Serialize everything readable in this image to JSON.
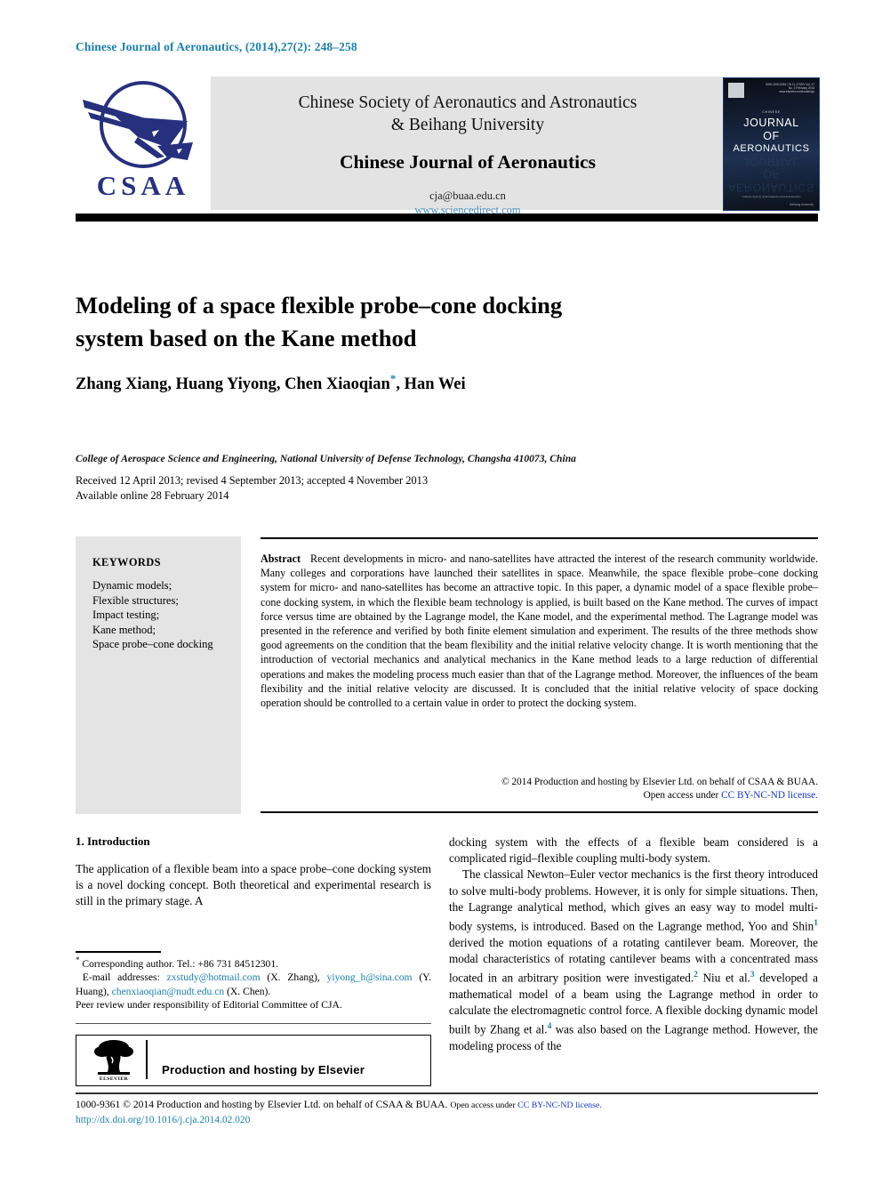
{
  "running_head": "Chinese Journal of Aeronautics, (2014),27(2): 248–258",
  "masthead": {
    "logo_text": "CSAA",
    "society_line1": "Chinese Society of Aeronautics and Astronautics",
    "society_line2": "& Beihang University",
    "journal_name": "Chinese Journal of Aeronautics",
    "email": "cja@buaa.edu.cn",
    "website": "www.sciencedirect.com",
    "cover": {
      "kicker": "CHINESE",
      "line1": "JOURNAL",
      "line2": "OF",
      "line3": "AERONAUTICS",
      "meta": "ISSN 1000-9361\nCN 11-1732/V\nVol. 27 No. 2 February 2014\nwww.elsevier.com/locate/cja",
      "footline": "Chinese Society of Aeronautics and Astronautics",
      "publisher": "Beihang University"
    }
  },
  "article": {
    "title_line1": "Modeling of a space flexible probe–cone docking",
    "title_line2": "system based on the Kane method",
    "authors": "Zhang Xiang, Huang Yiyong, Chen Xiaoqian",
    "authors_tail": ", Han Wei",
    "corresponding_marker": "*",
    "affiliation": "College of Aerospace Science and Engineering, National University of Defense Technology, Changsha 410073, China",
    "received": "Received 12 April 2013; revised 4 September 2013; accepted 4 November 2013",
    "available": "Available online 28 February 2014"
  },
  "keywords": {
    "heading": "KEYWORDS",
    "items": [
      "Dynamic models;",
      "Flexible structures;",
      "Impact testing;",
      "Kane method;",
      "Space probe–cone docking"
    ]
  },
  "abstract": {
    "label": "Abstract",
    "text": "Recent developments in micro- and nano-satellites have attracted the interest of the research community worldwide. Many colleges and corporations have launched their satellites in space. Meanwhile, the space flexible probe–cone docking system for micro- and nano-satellites has become an attractive topic. In this paper, a dynamic model of a space flexible probe–cone docking system, in which the flexible beam technology is applied, is built based on the Kane method. The curves of impact force versus time are obtained by the Lagrange model, the Kane model, and the experimental method. The Lagrange model was presented in the reference and verified by both finite element simulation and experiment. The results of the three methods show good agreements on the condition that the beam flexibility and the initial relative velocity change. It is worth mentioning that the introduction of vectorial mechanics and analytical mechanics in the Kane method leads to a large reduction of differential operations and makes the modeling process much easier than that of the Lagrange method. Moreover, the influences of the beam flexibility and the initial relative velocity are discussed. It is concluded that the initial relative velocity of space docking operation should be controlled to a certain value in order to protect the docking system.",
    "copyright": "© 2014 Production and hosting by Elsevier Ltd. on behalf of CSAA & BUAA.",
    "openaccess_prefix": "Open access under ",
    "license": "CC BY-NC-ND license."
  },
  "body": {
    "section_heading": "1. Introduction",
    "left_paragraph": "The application of a flexible beam into a space probe–cone docking system is a novel docking concept. Both theoretical and experimental research is still in the primary stage. A",
    "right_paragraph_1": "docking system with the effects of a flexible beam considered is a complicated rigid–flexible coupling multi-body system.",
    "right_paragraph_2_a": "The classical Newton–Euler vector mechanics is the first theory introduced to solve multi-body problems. However, it is only for simple situations. Then, the Lagrange analytical method, which gives an easy way to model multi-body systems, is introduced. Based on the Lagrange method, Yoo and Shin",
    "ref1": "1",
    "right_paragraph_2_b": " derived the motion equations of a rotating cantilever beam. Moreover, the modal characteristics of rotating cantilever beams with a concentrated mass located in an arbitrary position were investigated.",
    "ref2": "2",
    "right_paragraph_2_c": " Niu et al.",
    "ref3": "3",
    "right_paragraph_2_d": " developed a mathematical model of a beam using the Lagrange method in order to calculate the electromagnetic control force. A flexible docking dynamic model built by Zhang et al.",
    "ref4": "4",
    "right_paragraph_2_e": " was also based on the Lagrange method. However, the modeling process of the"
  },
  "footnotes": {
    "corresponding": "Corresponding author. Tel.: +86 731 84512301.",
    "email_label": "E-mail addresses:",
    "email1": "zxstudy@hotmail.com",
    "email1_owner": " (X. Zhang), ",
    "email2": "yiyong_h@sina.com",
    "email2_owner": " (Y. Huang), ",
    "email3": "chenxiaoqian@nudt.edu.cn",
    "email3_owner": " (X. Chen).",
    "peer_review": "Peer review under responsibility of Editorial Committee of CJA."
  },
  "production_box": {
    "text": "Production and hosting by Elsevier",
    "logo_word": "ELSEVIER"
  },
  "footer": {
    "issn_line": "1000-9361 © 2014 Production and hosting by Elsevier Ltd. on behalf of CSAA & BUAA.",
    "openaccess_prefix": "Open access under ",
    "license": "CC BY-NC-ND license.",
    "doi": "http://dx.doi.org/10.1016/j.cja.2014.02.020"
  },
  "colors": {
    "accent_teal": "#1b7fab",
    "logo_blue": "#26307d",
    "link_blue": "#1437c8",
    "band_gray": "#e3e3e3"
  }
}
